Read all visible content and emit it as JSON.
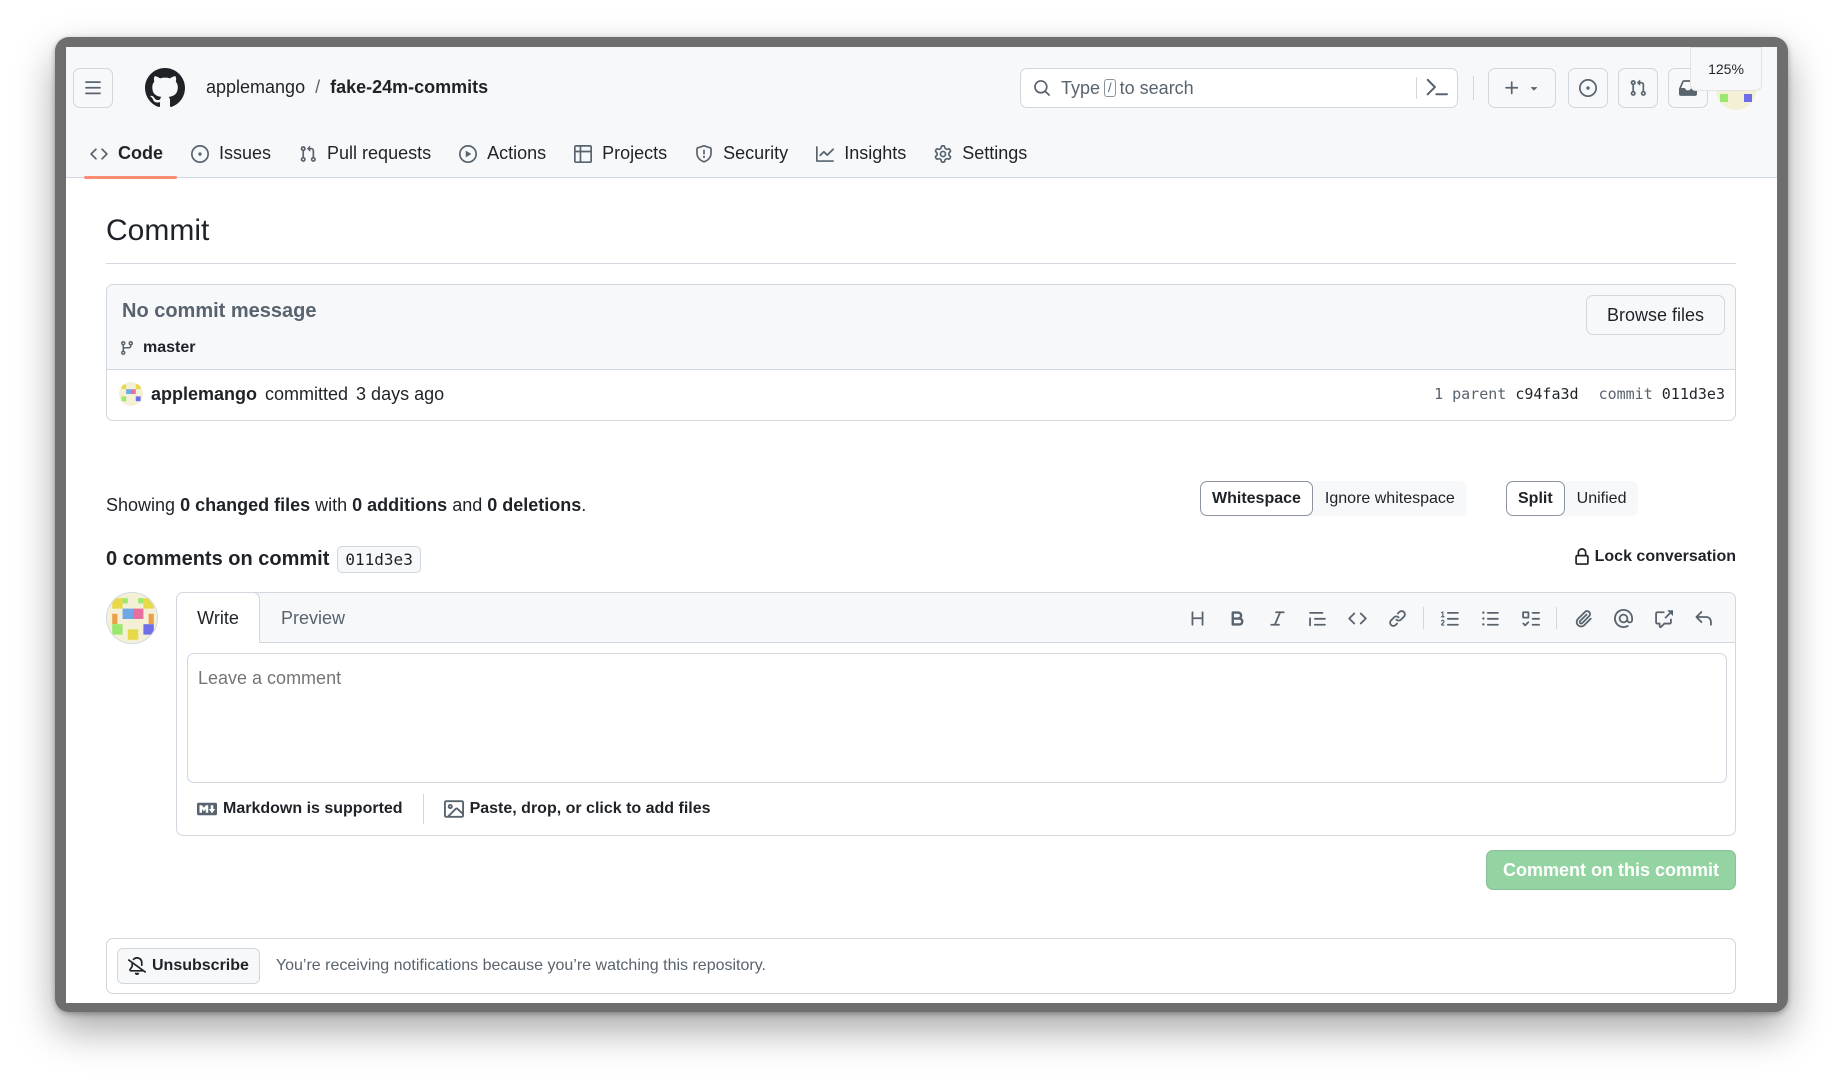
{
  "zoom": "125%",
  "header": {
    "owner": "applemango",
    "separator": "/",
    "repo": "fake-24m-commits",
    "search_prefix": "Type",
    "search_key": "/",
    "search_suffix": "to search"
  },
  "nav": {
    "items": [
      {
        "label": "Code",
        "icon": "code-icon"
      },
      {
        "label": "Issues",
        "icon": "issue-icon"
      },
      {
        "label": "Pull requests",
        "icon": "pull-request-icon"
      },
      {
        "label": "Actions",
        "icon": "play-icon"
      },
      {
        "label": "Projects",
        "icon": "table-icon"
      },
      {
        "label": "Security",
        "icon": "shield-icon"
      },
      {
        "label": "Insights",
        "icon": "graph-icon"
      },
      {
        "label": "Settings",
        "icon": "gear-icon"
      }
    ],
    "active": "Code"
  },
  "page": {
    "title": "Commit"
  },
  "commit": {
    "message": "No commit message",
    "branch": "master",
    "browse_label": "Browse files",
    "author": "applemango",
    "action": "committed",
    "time": "3 days ago",
    "parent_label": "1 parent",
    "parent_sha": "c94fa3d",
    "commit_label": "commit",
    "commit_sha": "011d3e3"
  },
  "diffstat": {
    "showing": "Showing",
    "changed_files": "0 changed files",
    "with": "with",
    "additions": "0 additions",
    "and": "and",
    "deletions": "0 deletions",
    "end": "."
  },
  "diff_options": {
    "whitespace": "Whitespace",
    "ignore_whitespace": "Ignore whitespace",
    "split": "Split",
    "unified": "Unified"
  },
  "comments": {
    "heading": "0 comments on commit",
    "sha": "011d3e3",
    "lock_label": "Lock conversation"
  },
  "editor": {
    "write_tab": "Write",
    "preview_tab": "Preview",
    "placeholder": "Leave a comment",
    "markdown_note": "Markdown is supported",
    "attach_note": "Paste, drop, or click to add files",
    "submit_label": "Comment on this commit"
  },
  "notifications": {
    "unsubscribe_label": "Unsubscribe",
    "reason": "You’re receiving notifications because you’re watching this repository."
  },
  "colors": {
    "accent_underline": "#fd8c73",
    "submit_disabled": "#94d3a2",
    "border": "#d0d7de",
    "muted_text": "#59636e"
  }
}
